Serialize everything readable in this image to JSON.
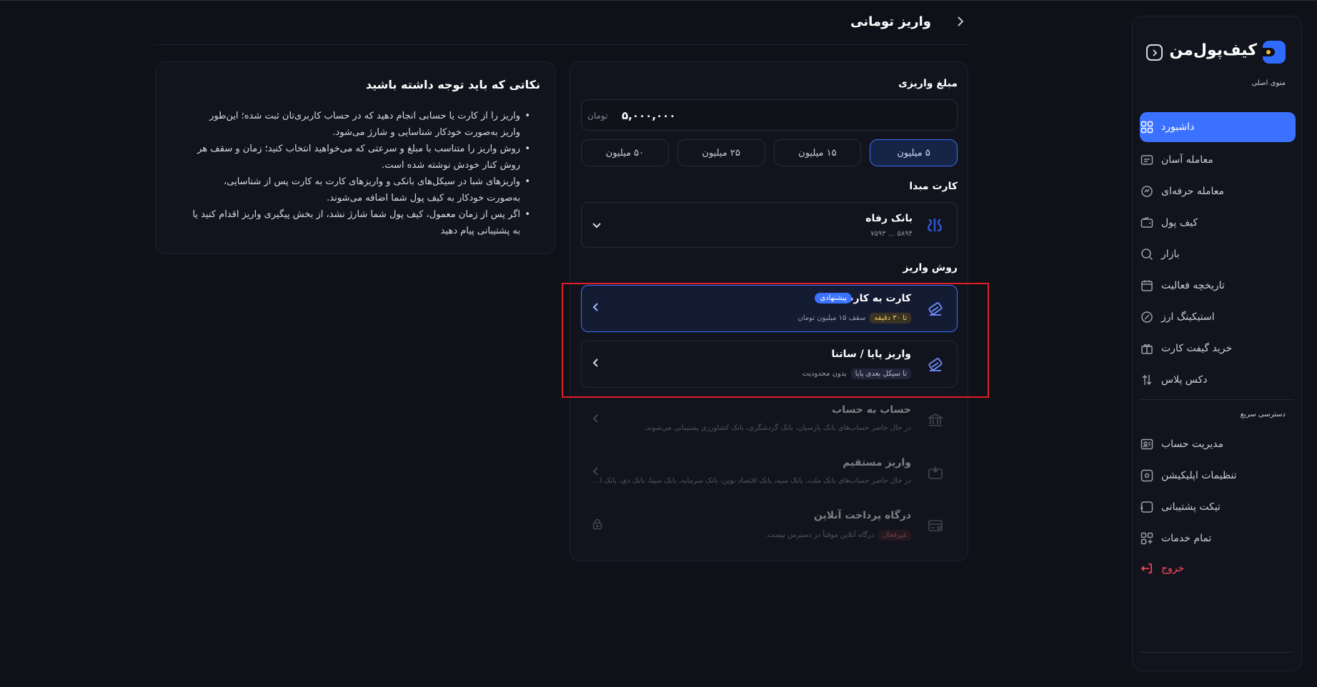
{
  "header": {
    "title": "واریز تومانی"
  },
  "sidebar": {
    "brand": "کیف‌پول‌من",
    "main_menu_label": "منوی اصلی",
    "main_items": [
      {
        "label": "داشبورد",
        "icon": "dashboard-icon",
        "active": true
      },
      {
        "label": "معامله آسان",
        "icon": "easy-trade-icon"
      },
      {
        "label": "معامله حرفه‌ای",
        "icon": "pro-trade-icon"
      },
      {
        "label": "کیف پول",
        "icon": "wallet-icon"
      },
      {
        "label": "بازار",
        "icon": "market-icon"
      },
      {
        "label": "تاریخچه فعالیت",
        "icon": "history-icon"
      },
      {
        "label": "استیکینگ ارز",
        "icon": "staking-icon"
      },
      {
        "label": "خرید گیفت کارت",
        "icon": "gift-card-icon"
      },
      {
        "label": "دکس پلاس",
        "icon": "dex-icon"
      }
    ],
    "quick_access_label": "دسترسی سریع",
    "quick_items": [
      {
        "label": "مدیریت حساب",
        "icon": "account-icon"
      },
      {
        "label": "تنظیمات اپلیکیشن",
        "icon": "settings-icon"
      },
      {
        "label": "تیکت پشتیبانی",
        "icon": "support-icon"
      },
      {
        "label": "تمام خدمات",
        "icon": "all-services-icon"
      }
    ],
    "logout_label": "خروج"
  },
  "deposit": {
    "amount_label": "مبلغ واریزی",
    "amount_value": "۵,۰۰۰,۰۰۰",
    "amount_unit": "تومان",
    "presets": [
      "۵ میلیون",
      "۱۵ میلیون",
      "۲۵ میلیون",
      "۵۰ میلیون"
    ],
    "selected_preset": "۵ میلیون",
    "source_card_label": "کارت مبدا",
    "source_card": {
      "bank": "بانک رفاه",
      "mask": "۵۸۹۴ ... ۷۵۹۳"
    },
    "method_label": "روش واریز",
    "methods": [
      {
        "title": "کارت به کارت",
        "badge": "پیشنهادی",
        "tag": "تا ۳۰ دقیقه",
        "sub": "سقف ۱۵ میلیون تومان"
      },
      {
        "title": "واریز پایا / ساتنا",
        "tag": "تا سیکل بعدی پایا",
        "sub": "بدون محدودیت"
      },
      {
        "title": "حساب به حساب",
        "sub": "در حال حاضر حساب‌های بانک  پارسیان، بانک گردشگری، بانک کشاورزی پشتیبانی می‌شوند."
      },
      {
        "title": "واریز مستقیم",
        "sub": "در حال حاضر حساب‌های بانک ملت، بانک سپه، بانک اقتصاد نوین، بانک سرمایه، بانک سینا، بانک دی، بانک ا..."
      },
      {
        "title": "درگاه پرداخت آنلاین",
        "tag": "غیرفعال",
        "sub": "درگاه آنلاین موقتاً در دسترس نیست."
      }
    ]
  },
  "notes": {
    "title": "نکاتی که باید توجه داشته باشید",
    "items": [
      "واریز را از کارت یا حسابی انجام دهید که در حساب کاربری‌تان ثبت شده؛ این‌طور واریز به‌صورت خودکار شناسایی و شارژ می‌شود.",
      "روش واریز را متناسب با مبلغ و سرعتی که می‌خواهید انتخاب کنید؛ زمان و سقف هر روش کنار خودش نوشته شده است.",
      "واریزهای شبا در سیکل‌های بانکی و واریزهای کارت به کارت پس از شناسایی، به‌صورت خودکار به کیف پول شما اضافه می‌شوند.",
      "اگر پس از زمان معمول، کیف پول شما شارژ نشد، از بخش پیگیری واریز اقدام کنید یا به پشتیبانی پیام دهید"
    ]
  },
  "colors": {
    "accent": "#3a72ff",
    "background": "#0f1119",
    "panel": "#12141d",
    "highlight": "#e01e27",
    "logout": "#ff4b5c"
  }
}
